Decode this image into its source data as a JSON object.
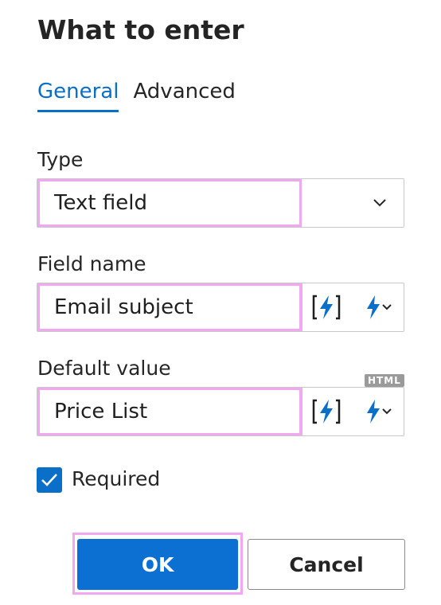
{
  "dialog": {
    "title": "What to enter"
  },
  "tabs": [
    {
      "label": "General",
      "active": true
    },
    {
      "label": "Advanced",
      "active": false
    }
  ],
  "type": {
    "label": "Type",
    "value": "Text field"
  },
  "field_name": {
    "label": "Field name",
    "value": "Email subject"
  },
  "default_value": {
    "label": "Default value",
    "value": "Price List",
    "badge": "HTML"
  },
  "required": {
    "label": "Required",
    "checked": true
  },
  "buttons": {
    "ok": "OK",
    "cancel": "Cancel"
  },
  "icons": {
    "dropdown": "chevron-down-icon",
    "insert_macro": "bracket-lightning-icon",
    "macro_menu": "lightning-dropdown-icon",
    "checkbox": "checkmark-icon"
  },
  "colors": {
    "accent": "#0a6fc9",
    "ok_bg": "#0b70d2",
    "highlight": "#f2a8f0",
    "badge_bg": "#9a9a9a"
  }
}
